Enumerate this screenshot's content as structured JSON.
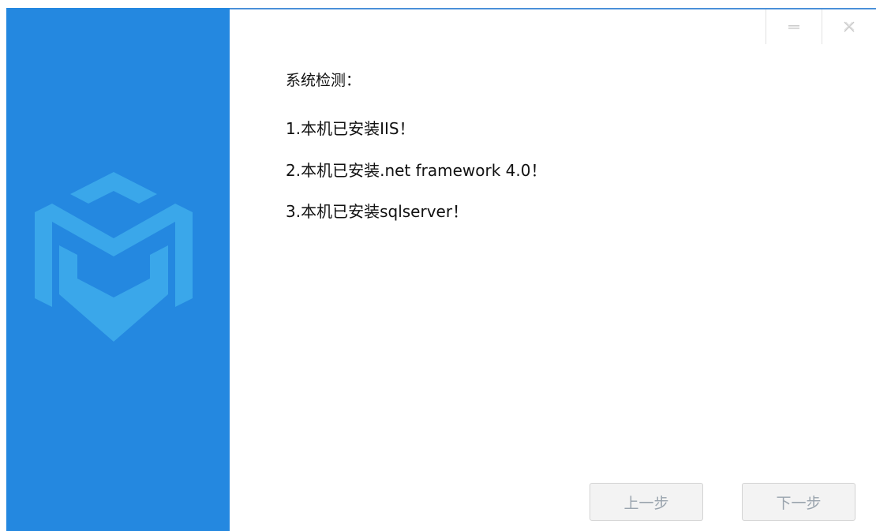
{
  "window": {
    "accent_color": "#2488e0",
    "controls": [
      {
        "name": "minimize",
        "icon": "minimize-icon"
      },
      {
        "name": "close",
        "icon": "close-icon"
      }
    ]
  },
  "sidebar": {
    "logo_icon": "cube-m-logo-icon",
    "logo_color": "#3aa7ea"
  },
  "main": {
    "heading": "系统检测：",
    "checks": [
      "1.本机已安装IIS！",
      "2.本机已安装.net framework 4.0！",
      "3.本机已安装sqlserver！"
    ]
  },
  "footer": {
    "prev_label": "上一步",
    "next_label": "下一步"
  }
}
